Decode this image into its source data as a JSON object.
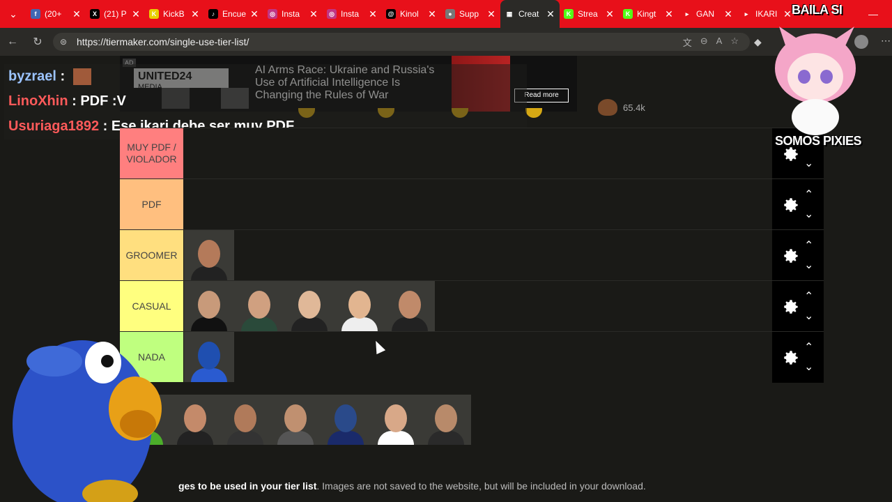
{
  "browser": {
    "tabs": [
      {
        "title": "(20+",
        "favicon": "f",
        "color": "#4267B2"
      },
      {
        "title": "(21) P",
        "favicon": "X",
        "color": "#000000"
      },
      {
        "title": "KickB",
        "favicon": "K",
        "color": "#e8d000"
      },
      {
        "title": "Encue",
        "favicon": "♪",
        "color": "#000000"
      },
      {
        "title": "Insta",
        "favicon": "◎",
        "color": "#c13584"
      },
      {
        "title": "Insta",
        "favicon": "◎",
        "color": "#c13584"
      },
      {
        "title": "Kinol",
        "favicon": "@",
        "color": "#000000"
      },
      {
        "title": "Supp",
        "favicon": "●",
        "color": "#777777"
      },
      {
        "title": "Creat",
        "favicon": "▦",
        "color": "#2b2a27",
        "active": true
      },
      {
        "title": "Strea",
        "favicon": "K",
        "color": "#53fc18"
      },
      {
        "title": "Kingt",
        "favicon": "K",
        "color": "#53fc18"
      },
      {
        "title": "GAN",
        "favicon": "▸",
        "color": "#e8101a"
      },
      {
        "title": "IKARI",
        "favicon": "▸",
        "color": "#e8101a"
      }
    ],
    "url": "https://tiermaker.com/single-use-tier-list/"
  },
  "ad": {
    "tag": "AD",
    "brand": "UNITED24",
    "brand_sub": "MEDIA",
    "headline": "AI Arms Race: Ukraine and Russia's Use of Artificial Intelligence Is Changing the Rules of War",
    "button": "Read more"
  },
  "stats": {
    "count": "65.4k"
  },
  "chat": [
    {
      "user": "byzrael",
      "color": "#9cc4ff",
      "message": "",
      "has_avatar": true
    },
    {
      "user": "LinoXhin",
      "color": "#ff5a5a",
      "message": "PDF :V"
    },
    {
      "user": "Usuriaga1892",
      "color": "#ff5a5a",
      "message": "Ese ikari debe ser muy PDF"
    }
  ],
  "tiers": [
    {
      "label": "MUY PDF / VIOLADOR",
      "color": "#ff7f7f",
      "items": []
    },
    {
      "label": "PDF",
      "color": "#ffbf7f",
      "items": [
        {
          "skin": "#c48a6a",
          "shirt": "#333"
        }
      ]
    },
    {
      "label": "GROOMER",
      "color": "#ffdf7f",
      "items": [
        {
          "skin": "#b47a5a",
          "shirt": "#222"
        }
      ]
    },
    {
      "label": "CASUAL",
      "color": "#ffff7f",
      "items": [
        {
          "skin": "#c89a7a",
          "shirt": "#111"
        },
        {
          "skin": "#d0a080",
          "shirt": "#2a4a3a"
        },
        {
          "skin": "#e0b898",
          "shirt": "#222"
        },
        {
          "skin": "#e2b590",
          "shirt": "#eee"
        },
        {
          "skin": "#c08a6a",
          "shirt": "#222"
        }
      ]
    },
    {
      "label": "NADA",
      "color": "#bfff7f",
      "items": [
        {
          "skin": "#1f4fb0",
          "shirt": "#2a5bd0"
        }
      ]
    }
  ],
  "pool": [
    {
      "skin": "#7bd35a",
      "shirt": "#4cae2a"
    },
    {
      "skin": "#c48a6a",
      "shirt": "#222"
    },
    {
      "skin": "#b07a5a",
      "shirt": "#333"
    },
    {
      "skin": "#c09070",
      "shirt": "#555"
    },
    {
      "skin": "#2a4a8a",
      "shirt": "#1a2a6a"
    },
    {
      "skin": "#d8a888",
      "shirt": "#fff"
    },
    {
      "skin": "#b88a6a",
      "shirt": "#2a2a2a"
    }
  ],
  "footer": {
    "bold": "ges to be used in your tier list",
    "rest": ". Images are not saved to the website, but will be included in your download."
  },
  "overlays": {
    "top_text": "BAILA SI",
    "bottom_text": "SOMOS PIXIES"
  }
}
